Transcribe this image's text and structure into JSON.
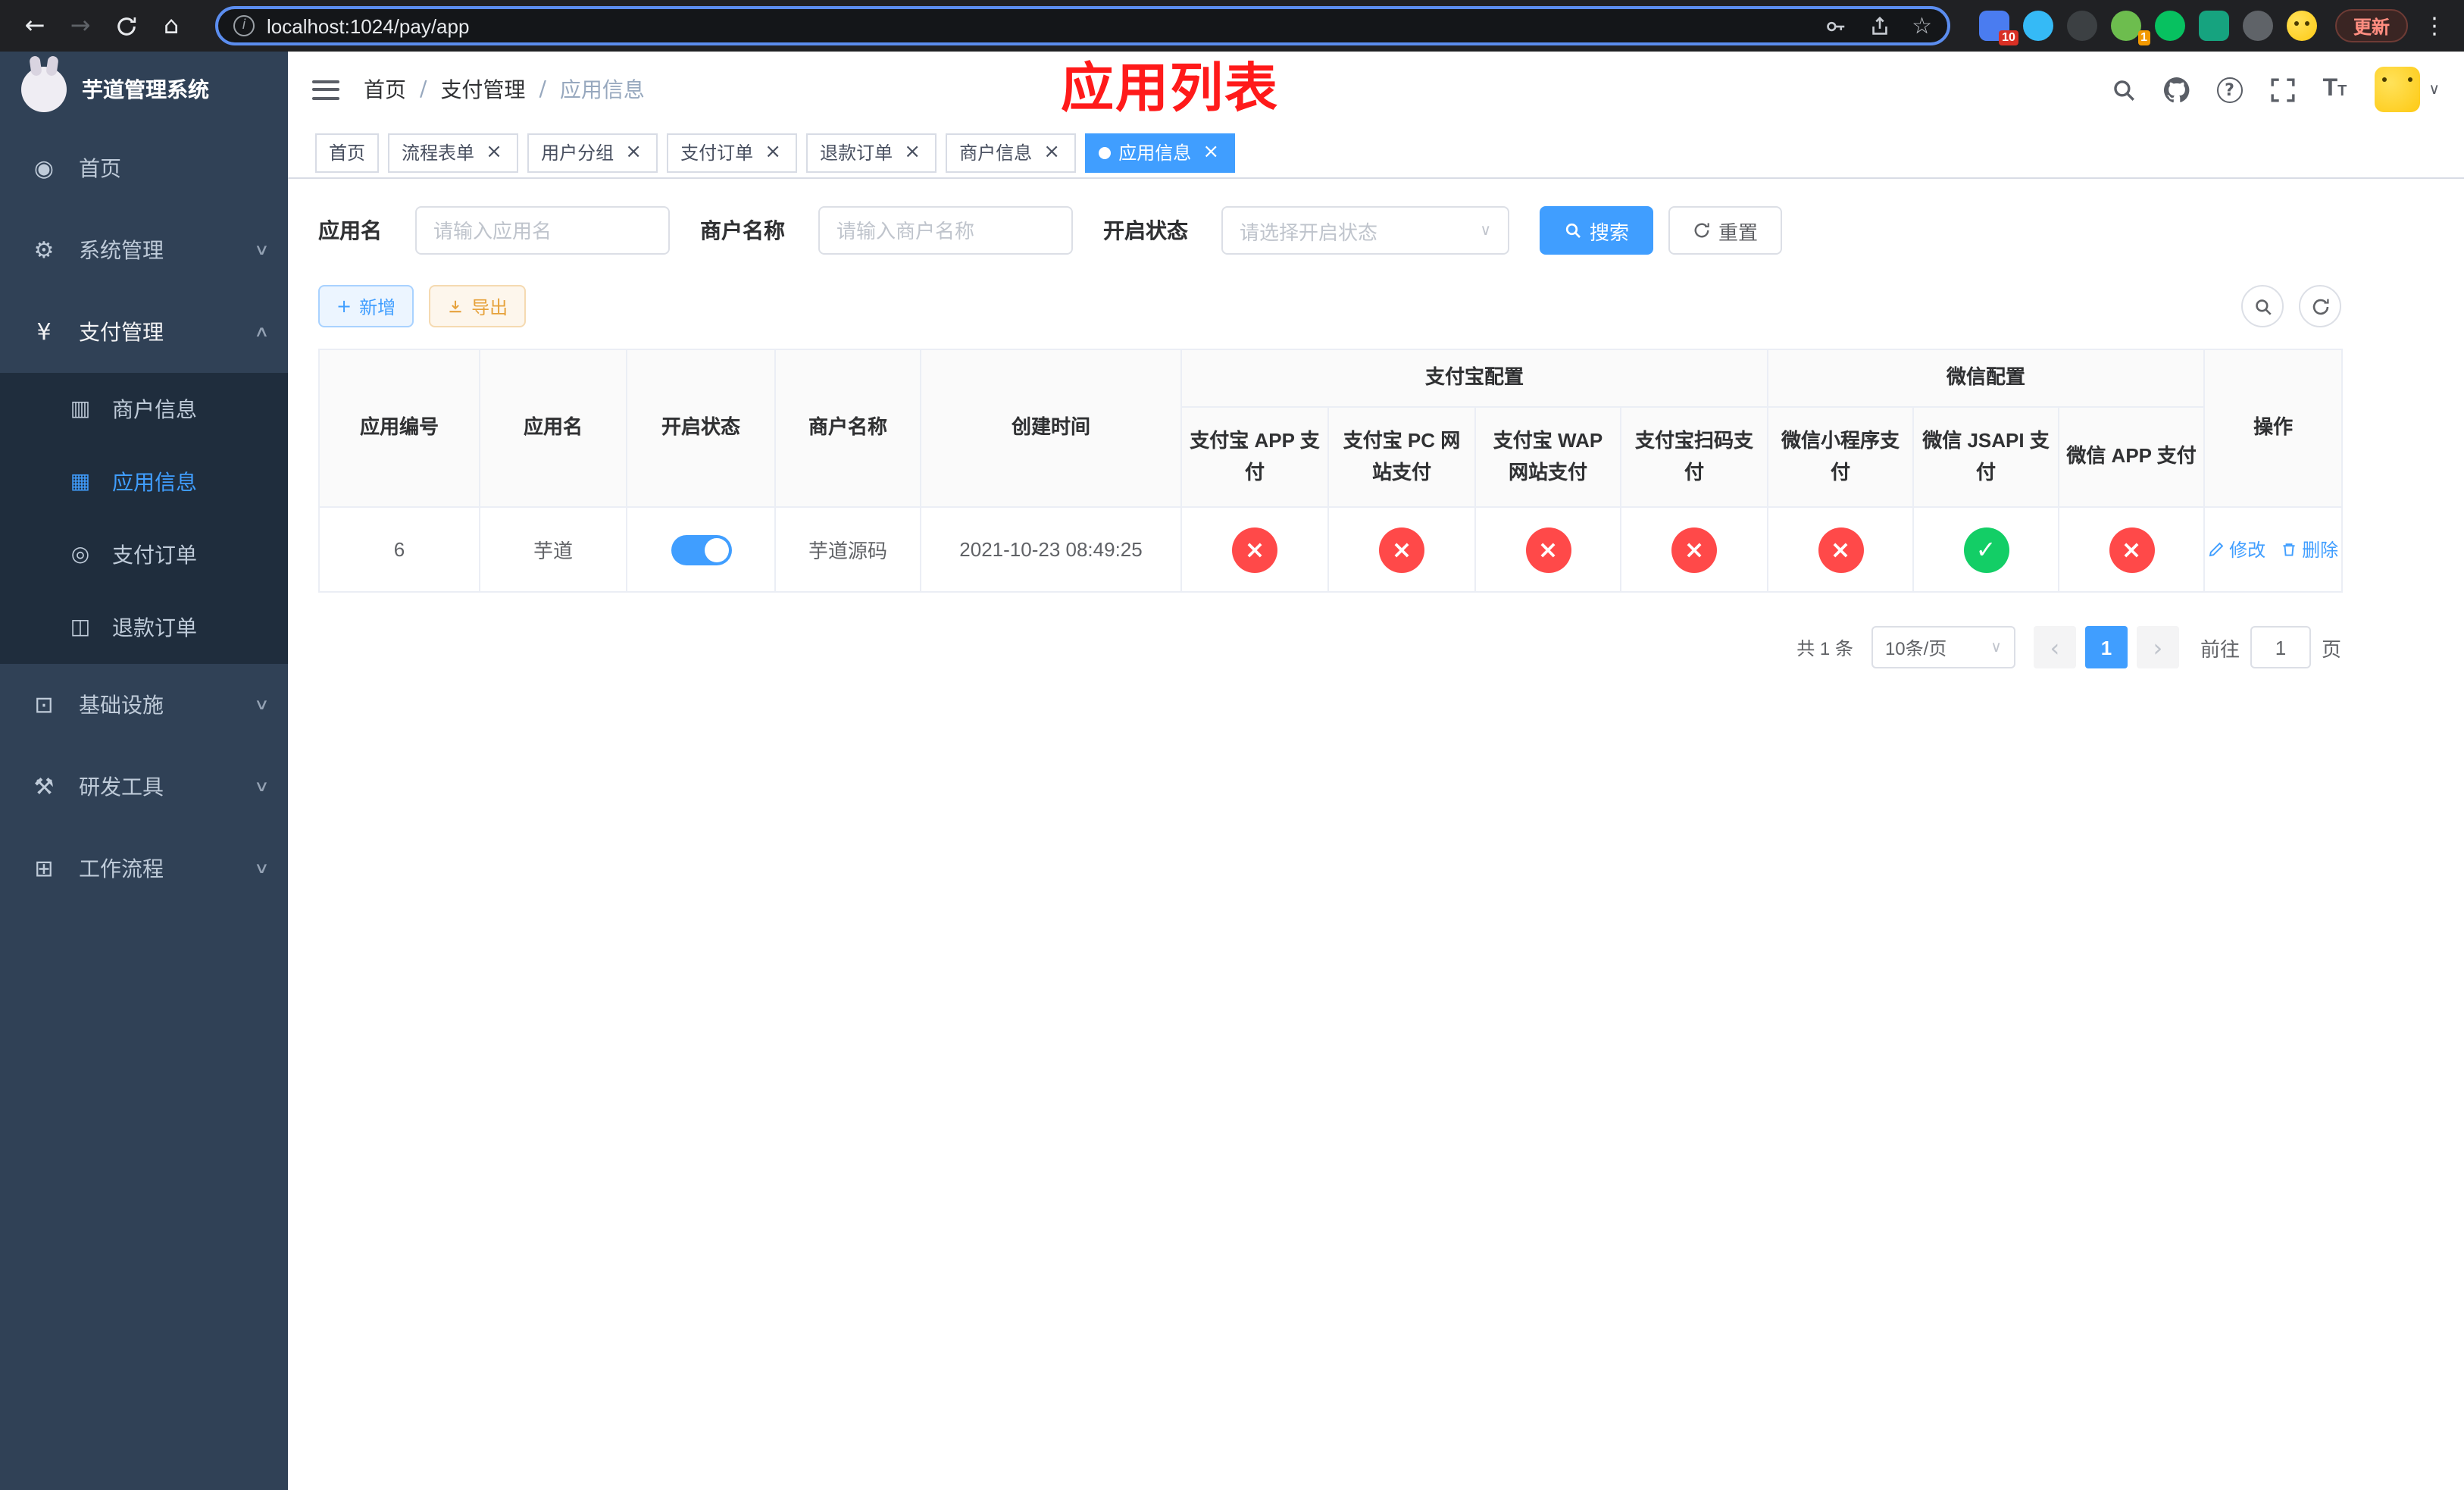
{
  "colors": {
    "primary": "#409eff",
    "success": "#13ce66",
    "danger": "#ff4949",
    "warning": "#e6a23c",
    "sidebar_bg": "#304156",
    "submenu_bg": "#1f2d3d",
    "annotation": "#ff1a1a"
  },
  "icons": {
    "back": "←",
    "forward": "→",
    "home": "⌂",
    "info": "i",
    "star": "☆",
    "menu_dots": "⋮",
    "close": "×",
    "separator": "/",
    "chevron_down": "∨",
    "chevron_up": "∧",
    "caret_down": "∨",
    "plus": "+",
    "check": "✓",
    "cross": "×",
    "prev": "‹",
    "next": "›",
    "question": "?",
    "tsize_big": "T",
    "tsize_small": "T",
    "dashboard": "◉",
    "gear": "⚙",
    "yen": "¥",
    "merchant_card": "▥",
    "app_grid": "▦",
    "pay_order": "◎",
    "refund_order": "◫",
    "infra": "⊡",
    "devtools": "⚒",
    "workflow": "⊞"
  },
  "browser": {
    "url": "localhost:1024/pay/app",
    "update_button": "更新",
    "extension_badge": "10",
    "profile_badge": "1"
  },
  "sidebar": {
    "title": "芋道管理系统",
    "items": {
      "home": "首页",
      "system": "系统管理",
      "payment": "支付管理",
      "merchant": "商户信息",
      "app_info": "应用信息",
      "pay_order": "支付订单",
      "refund_order": "退款订单",
      "infra": "基础设施",
      "devtools": "研发工具",
      "workflow": "工作流程"
    }
  },
  "header": {
    "breadcrumb": [
      "首页",
      "支付管理",
      "应用信息"
    ],
    "annotation": "应用列表"
  },
  "tabs": [
    {
      "label": "首页",
      "closable": false,
      "active": false
    },
    {
      "label": "流程表单",
      "closable": true,
      "active": false
    },
    {
      "label": "用户分组",
      "closable": true,
      "active": false
    },
    {
      "label": "支付订单",
      "closable": true,
      "active": false
    },
    {
      "label": "退款订单",
      "closable": true,
      "active": false
    },
    {
      "label": "商户信息",
      "closable": true,
      "active": false
    },
    {
      "label": "应用信息",
      "closable": true,
      "active": true
    }
  ],
  "filters": {
    "app_name_label": "应用名",
    "app_name_placeholder": "请输入应用名",
    "merchant_label": "商户名称",
    "merchant_placeholder": "请输入商户名称",
    "status_label": "开启状态",
    "status_placeholder": "请选择开启状态",
    "search_button": "搜索",
    "reset_button": "重置"
  },
  "toolbar": {
    "add_button": "新增",
    "export_button": "导出"
  },
  "table": {
    "headers": {
      "app_id": "应用编号",
      "app_name": "应用名",
      "status": "开启状态",
      "merchant": "商户名称",
      "created": "创建时间",
      "alipay_group": "支付宝配置",
      "wechat_group": "微信配置",
      "alipay_app": "支付宝 APP 支付",
      "alipay_pc": "支付宝 PC 网站支付",
      "alipay_wap": "支付宝 WAP 网站支付",
      "alipay_qr": "支付宝扫码支付",
      "wx_mini": "微信小程序支付",
      "wx_jsapi": "微信 JSAPI 支付",
      "wx_app": "微信 APP 支付",
      "actions": "操作"
    },
    "rows": [
      {
        "app_id": "6",
        "app_name": "芋道",
        "enabled": true,
        "merchant": "芋道源码",
        "created": "2021-10-23 08:49:25",
        "channels": {
          "alipay_app": false,
          "alipay_pc": false,
          "alipay_wap": false,
          "alipay_qr": false,
          "wx_mini": false,
          "wx_jsapi": true,
          "wx_app": false
        },
        "edit_label": "修改",
        "delete_label": "删除"
      }
    ]
  },
  "pagination": {
    "total": "共 1 条",
    "page_size": "10条/页",
    "page": "1",
    "goto_label": "前往",
    "goto_value": "1",
    "page_unit": "页"
  }
}
